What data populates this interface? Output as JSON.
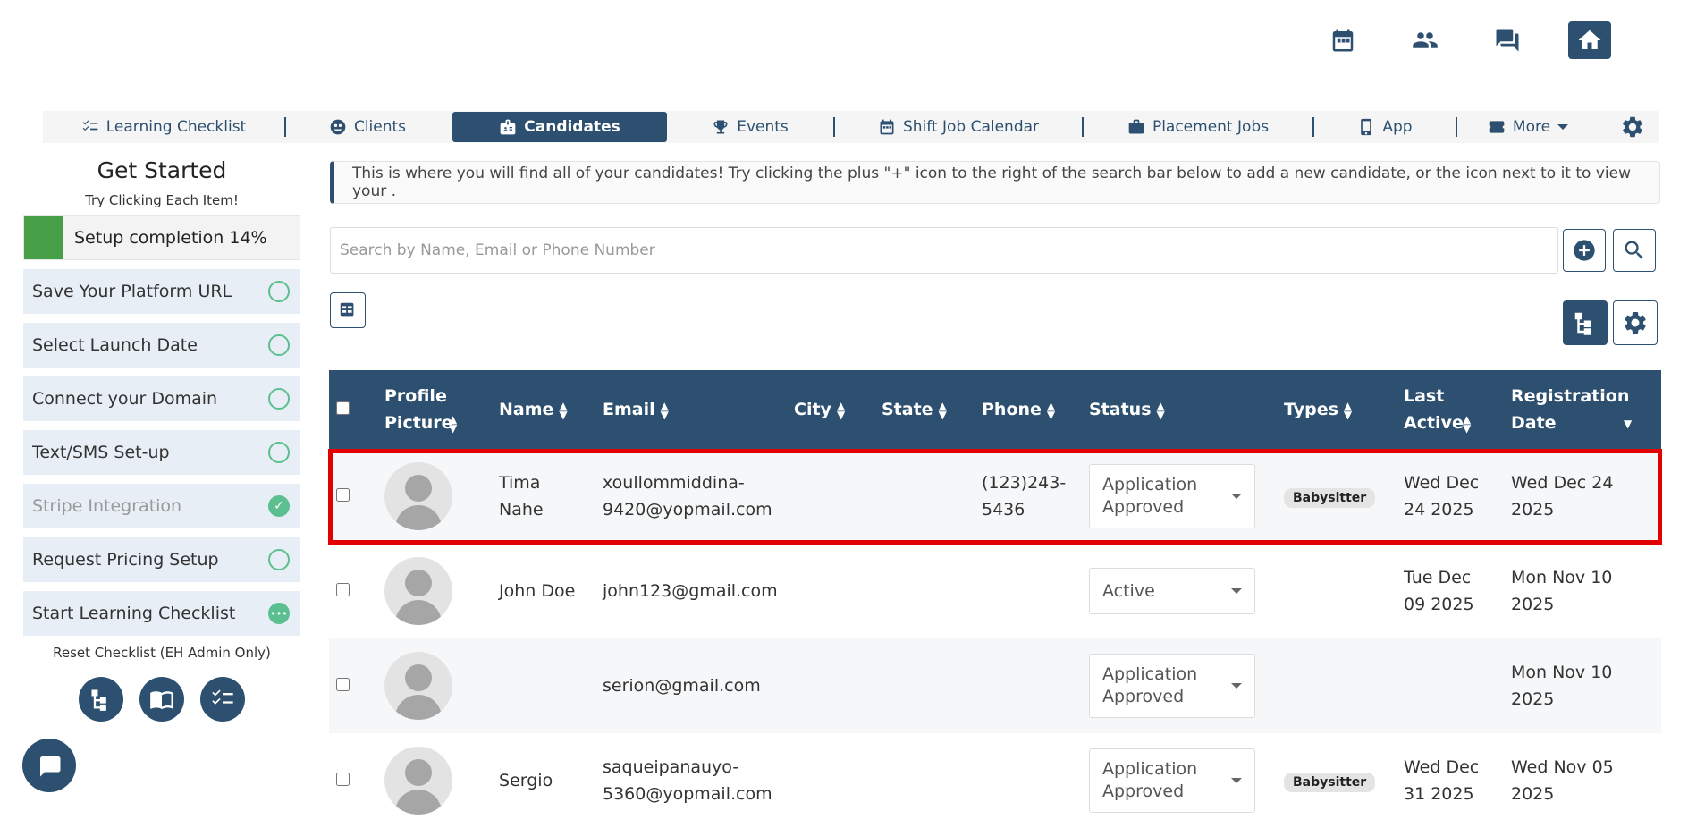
{
  "top_icons": [
    "calendar-icon",
    "people-icon",
    "chat-icon",
    "home-icon"
  ],
  "nav": {
    "items": [
      {
        "label": "Learning Checklist",
        "icon": "checklist-icon"
      },
      {
        "label": "Clients",
        "icon": "clients-icon"
      },
      {
        "label": "Candidates",
        "icon": "candidates-icon",
        "active": true
      },
      {
        "label": "Events",
        "icon": "trophy-icon"
      },
      {
        "label": "Shift Job Calendar",
        "icon": "calendar-icon"
      },
      {
        "label": "Placement Jobs",
        "icon": "briefcase-icon"
      },
      {
        "label": "App",
        "icon": "phone-icon"
      },
      {
        "label": "More",
        "icon": "ticket-icon"
      }
    ],
    "settings_icon": "gear-icon"
  },
  "sidebar": {
    "title": "Get Started",
    "subtitle": "Try Clicking Each Item!",
    "progress_label": "Setup completion 14%",
    "progress_percent": 14,
    "items": [
      {
        "label": "Save Your Platform URL",
        "state": "todo"
      },
      {
        "label": "Select Launch Date",
        "state": "todo"
      },
      {
        "label": "Connect your Domain",
        "state": "todo"
      },
      {
        "label": "Text/SMS Set-up",
        "state": "todo"
      },
      {
        "label": "Stripe Integration",
        "state": "done"
      },
      {
        "label": "Request Pricing Setup",
        "state": "todo"
      },
      {
        "label": "Start Learning Checklist",
        "state": "in-progress"
      }
    ],
    "reset_label": "Reset Checklist (EH Admin Only)"
  },
  "info_text": "This is where you will find all of your candidates! Try clicking the plus \"+\" icon to the right of the search bar below to add a new candidate, or the icon next to it to view your .",
  "search": {
    "placeholder": "Search by Name, Email or Phone Number"
  },
  "table": {
    "headers": {
      "profile": "Profile Picture",
      "name": "Name",
      "email": "Email",
      "city": "City",
      "state": "State",
      "phone": "Phone",
      "status": "Status",
      "types": "Types",
      "last_active": "Last Active",
      "registration": "Registration Date"
    },
    "rows": [
      {
        "name": "Tima Nahe",
        "email": "xoullommiddina-9420@yopmail.com",
        "city": "",
        "state": "",
        "phone": "(123)243-5436",
        "status": "Application Approved",
        "type": "Babysitter",
        "last_active": "Wed Dec 24 2025",
        "registration": "Wed Dec 24 2025"
      },
      {
        "name": "John Doe",
        "email": "john123@gmail.com",
        "city": "",
        "state": "",
        "phone": "",
        "status": "Active",
        "type": "",
        "last_active": "Tue Dec 09 2025",
        "registration": "Mon Nov 10 2025"
      },
      {
        "name": "",
        "email": "serion@gmail.com",
        "city": "",
        "state": "",
        "phone": "",
        "status": "Application Approved",
        "type": "",
        "last_active": "",
        "registration": "Mon Nov 10 2025"
      },
      {
        "name": "Sergio",
        "email": "saqueipanauyo-5360@yopmail.com",
        "city": "",
        "state": "",
        "phone": "",
        "status": "Application Approved",
        "type": "Babysitter",
        "last_active": "Wed Dec 31 2025",
        "registration": "Wed Nov 05 2025"
      }
    ]
  },
  "colors": {
    "primary": "#2d5070",
    "progress": "#47a047",
    "check": "#5bbf8f",
    "highlight": "#e30000"
  }
}
